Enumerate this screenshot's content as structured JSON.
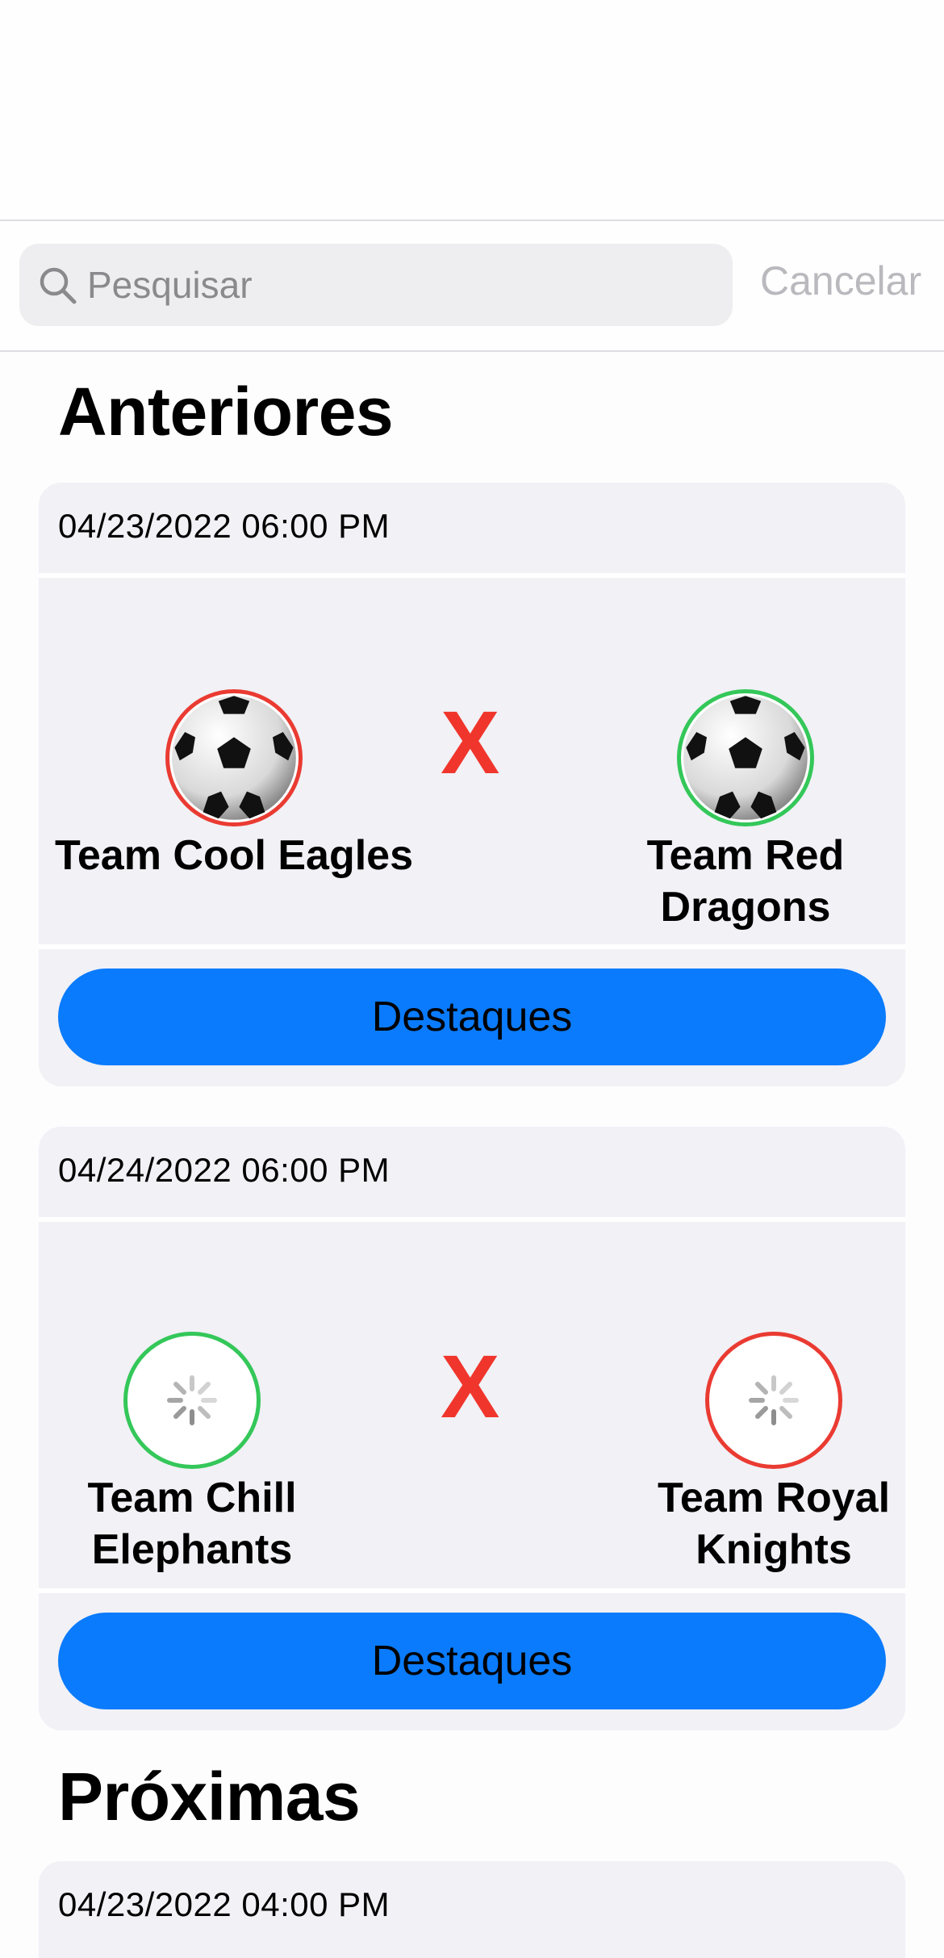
{
  "search": {
    "placeholder": "Pesquisar",
    "value": "",
    "cancel_label": "Cancelar"
  },
  "sections": {
    "past_title": "Anteriores",
    "upcoming_title": "Próximas"
  },
  "matches_past": [
    {
      "date": "04/23/2022 06:00 PM",
      "home": {
        "name": "Team Cool Eagles",
        "logo": "soccer-ball",
        "border": "#ea3b32"
      },
      "away": {
        "name": "Team Red Dragons",
        "logo": "soccer-ball",
        "border": "#34c759"
      },
      "versus": "X",
      "button_label": "Destaques"
    },
    {
      "date": "04/24/2022 06:00 PM",
      "home": {
        "name": "Team Chill Elephants",
        "logo": "loading-spinner",
        "border": "#34c759"
      },
      "away": {
        "name": "Team Royal Knights",
        "logo": "loading-spinner",
        "border": "#ea3b32"
      },
      "versus": "X",
      "button_label": "Destaques"
    }
  ],
  "matches_upcoming": [
    {
      "date": "04/23/2022 04:00 PM"
    }
  ],
  "colors": {
    "accent": "#0a7bfc",
    "versus": "#f0362c",
    "win": "#34c759",
    "loss": "#ea3b32",
    "card": "#f1f1f6"
  }
}
